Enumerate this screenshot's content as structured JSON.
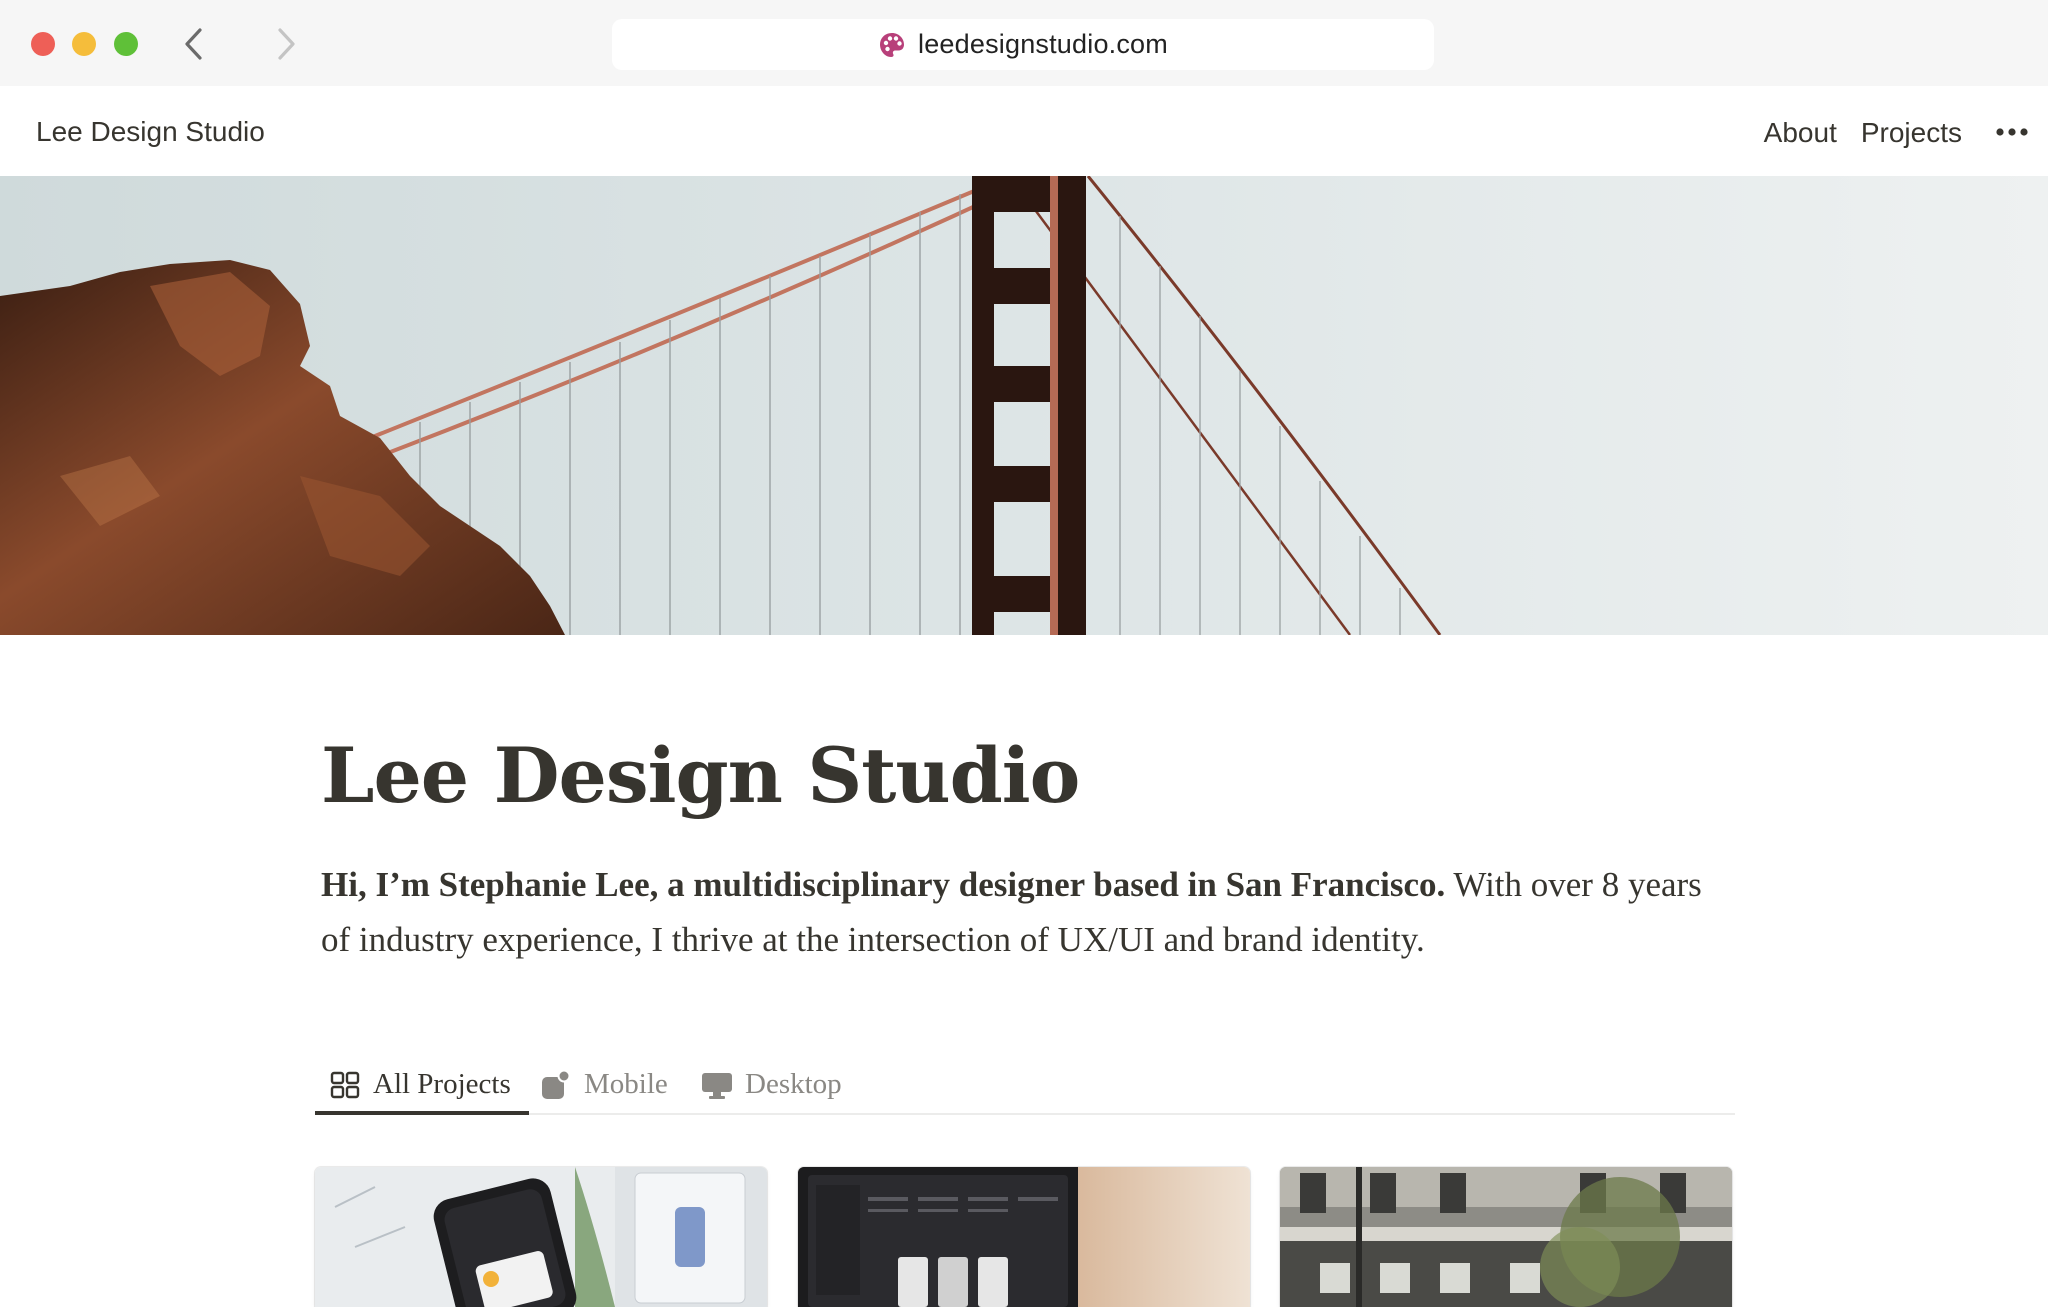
{
  "browser": {
    "url": "leedesignstudio.com",
    "back_icon": "chevron-left-icon",
    "forward_icon": "chevron-right-icon",
    "favicon": "palette-icon"
  },
  "header": {
    "site_name": "Lee Design Studio",
    "nav": [
      {
        "label": "About"
      },
      {
        "label": "Projects"
      }
    ],
    "more_icon": "more-horizontal-icon"
  },
  "cover": {
    "icon": "golden-gate-bridge-photo"
  },
  "page": {
    "title": "Lee Design Studio",
    "intro_bold": "Hi, I’m Stephanie Lee, a multidisciplinary designer based in San Francisco.",
    "intro_rest": " With over 8 years of industry experience, I thrive at the intersection of UX/UI and brand identity."
  },
  "tabs": [
    {
      "label": "All Projects",
      "icon": "gallery-grid-icon",
      "active": true
    },
    {
      "label": "Mobile",
      "icon": "mobile-icon",
      "active": false
    },
    {
      "label": "Desktop",
      "icon": "desktop-icon",
      "active": false
    }
  ],
  "cards": [
    {
      "image": "phone-app-photo"
    },
    {
      "image": "laptop-screen-photo"
    },
    {
      "image": "building-facade-photo"
    }
  ],
  "colors": {
    "text": "#37352f",
    "muted": "#8a8884",
    "chrome": "#f6f6f6",
    "cable": "#c27560"
  }
}
